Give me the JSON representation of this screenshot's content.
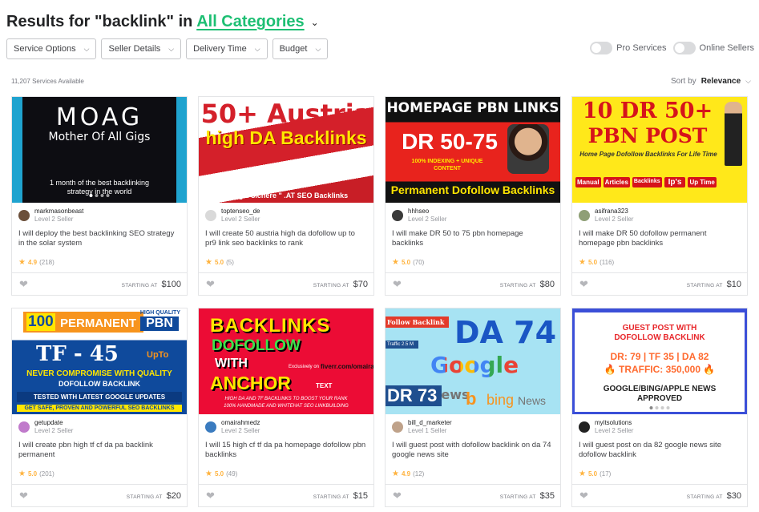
{
  "header": {
    "prefix": "Results for \"backlink\" in",
    "category": "All Categories"
  },
  "filters": [
    "Service Options",
    "Seller Details",
    "Delivery Time",
    "Budget"
  ],
  "toggles": {
    "pro": "Pro Services",
    "online": "Online Sellers"
  },
  "results_count": "11,207 Services Available",
  "sort": {
    "label": "Sort by",
    "value": "Relevance"
  },
  "starting_at_label": "STARTING AT",
  "gigs": [
    {
      "seller": "markmasonbeast",
      "level": "Level 2 Seller",
      "title": "I will deploy the best backlinking SEO strategy in the solar system",
      "rating": "4.9",
      "reviews": "(218)",
      "price": "$100",
      "thumb": {
        "l1": "MOAG",
        "l2": "Mother Of All Gigs",
        "l3": "1 month of the best backlinking strategy in the world"
      }
    },
    {
      "seller": "toptenseo_de",
      "level": "Level 2 Seller",
      "title": "I will create 50 austria high da dofollow up to pr9 link seo backlinks to rank",
      "rating": "5.0",
      "reviews": "(5)",
      "price": "$70",
      "thumb": {
        "l1": "50+ Austria",
        "l2": "high DA Backlinks",
        "l3": "Google sichere \" .AT SEO Backlinks"
      }
    },
    {
      "seller": "hhhseo",
      "level": "Level 2 Seller",
      "title": "I will make DR 50 to 75 pbn homepage backlinks",
      "rating": "5.0",
      "reviews": "(70)",
      "price": "$80",
      "thumb": {
        "l1": "HOMEPAGE PBN LINKS",
        "l2": "DR 50-75",
        "l3": "100% INDEXING + UNIQUE CONTENT",
        "l4": "Permanent Dofollow Backlinks"
      }
    },
    {
      "seller": "asifrana323",
      "level": "Level 2 Seller",
      "title": "I will make DR 50 dofollow permanent homepage pbn backlinks",
      "rating": "5.0",
      "reviews": "(116)",
      "price": "$10",
      "thumb": {
        "l1": "10 DR 50+",
        "l2": "PBN POST",
        "l3": "Home Page Dofollow Backlinks For Life Time",
        "tags": [
          "Manual",
          "Articles",
          "Backlinks",
          "Ip's",
          "Up Time"
        ]
      }
    },
    {
      "seller": "getupdate",
      "level": "Level 2 Seller",
      "title": "I will create pbn high tf cf da pa backlink permanent",
      "rating": "5.0",
      "reviews": "(201)",
      "price": "$20",
      "thumb": {
        "l1": "100",
        "l2": "PERMANENT",
        "l3": "PBN",
        "l4": "TF - 45",
        "l5": "UpTo",
        "l6": "NEVER COMPROMISE WITH QUALITY",
        "l7": "DOFOLLOW BACKLINK",
        "l8": "TESTED WITH LATEST GOOGLE UPDATES",
        "l9": "GET SAFE, PROVEN AND POWERFUL SEO BACKLINKS",
        "l10": "HIGH QUALITY"
      }
    },
    {
      "seller": "omairahmedz",
      "level": "Level 2 Seller",
      "title": "I will 15 high cf tf da pa homepage dofollow pbn backlinks",
      "rating": "5.0",
      "reviews": "(49)",
      "price": "$15",
      "thumb": {
        "l1": "BACKLINKS",
        "l2": "DOFOLLOW",
        "l3": "WITH",
        "l4": "ANCHOR",
        "l5": "TEXT",
        "l6": "Exclusively on",
        "l7": "fiverr.com/omairahmedz",
        "l8": "HIGH DA AND TF BACKLINKS TO BOOST YOUR RANK",
        "l9": "100% HANDMADE AND WHITEHAT SEO LINKBUILDING"
      }
    },
    {
      "seller": "bill_d_marketer",
      "level": "Level 1 Seller",
      "title": "I will guest post with dofollow backlink on da 74 google news site",
      "rating": "4.9",
      "reviews": "(12)",
      "price": "$35",
      "thumb": {
        "l1": "Follow Backlink",
        "l2": "DA 74",
        "l3": "Traffic 2.5 M",
        "l4": "Google",
        "l5": "News",
        "l6": "DR 73",
        "l7": "bing",
        "l8": "News"
      }
    },
    {
      "seller": "myitsolutions",
      "level": "Level 2 Seller",
      "title": "I will guest post on da 82 google news site dofollow backlink",
      "rating": "5.0",
      "reviews": "(17)",
      "price": "$30",
      "thumb": {
        "l1": "GUEST POST WITH",
        "l2": "DOFOLLOW BACKLINK",
        "l3": "DR: 79 | TF 35 | DA 82",
        "l4": "TRAFFIC: 350,000",
        "l5": "GOOGLE/BING/APPLE NEWS",
        "l6": "APPROVED"
      }
    }
  ]
}
